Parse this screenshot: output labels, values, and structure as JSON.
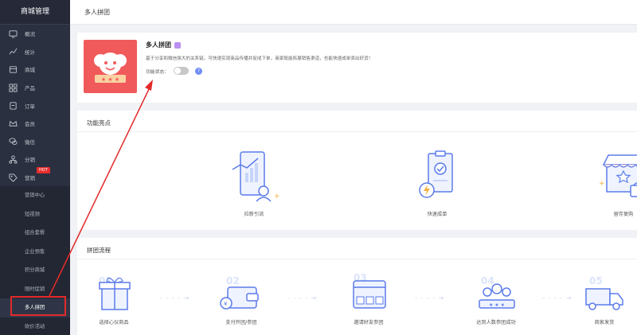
{
  "sidebar": {
    "title": "商城管理",
    "items": [
      {
        "label": "概况",
        "icon": "monitor-icon"
      },
      {
        "label": "统计",
        "icon": "chart-icon"
      },
      {
        "label": "商城",
        "icon": "store-icon"
      },
      {
        "label": "产品",
        "icon": "grid-icon"
      },
      {
        "label": "订单",
        "icon": "clipboard-icon"
      },
      {
        "label": "会员",
        "icon": "crown-icon"
      },
      {
        "label": "微信",
        "icon": "wechat-icon"
      },
      {
        "label": "分销",
        "icon": "network-icon"
      },
      {
        "label": "营销",
        "icon": "tag-icon",
        "badge": "HOT"
      }
    ],
    "sub_items": [
      "营销中心",
      "短视频",
      "组合套餐",
      "企业预售",
      "积分商城",
      "限时促销",
      "多人拼团",
      "砍价活动"
    ],
    "active_sub": "多人拼团"
  },
  "header": {
    "breadcrumb": "多人拼团"
  },
  "info": {
    "title": "多人拼团",
    "description": "基于分享和微信强大的关系链，可快速实现商品传播并促成下单，商家既能拓展销售渠道，也能快速成单卖出好货！",
    "switch_label": "功能状态：",
    "switch_on": false,
    "help": "?"
  },
  "features": {
    "title": "功能亮点",
    "items": [
      {
        "label": "拉新引流",
        "icon": "growth-phone-icon"
      },
      {
        "label": "快速成单",
        "icon": "fast-order-icon"
      },
      {
        "label": "留存复购",
        "icon": "repurchase-shop-icon"
      }
    ]
  },
  "flow": {
    "title": "拼团流程",
    "steps": [
      {
        "num": "01",
        "label": "选择心仪商品",
        "icon": "gift-icon"
      },
      {
        "num": "02",
        "label": "支付开团/参团",
        "icon": "wallet-icon"
      },
      {
        "num": "03",
        "label": "邀请好友参团",
        "icon": "invite-screen-icon"
      },
      {
        "num": "04",
        "label": "达到人数参团成功",
        "icon": "group-icon"
      },
      {
        "num": "05",
        "label": "商家发货",
        "icon": "truck-icon"
      }
    ],
    "connector": "- - - - →"
  },
  "colors": {
    "sidebar_bg": "#2b3040",
    "accent_red": "#e32a2a",
    "brand_logo": "#f15a5a",
    "switch_off": "#c7c7c7",
    "help_blue": "#6f8cf7"
  }
}
